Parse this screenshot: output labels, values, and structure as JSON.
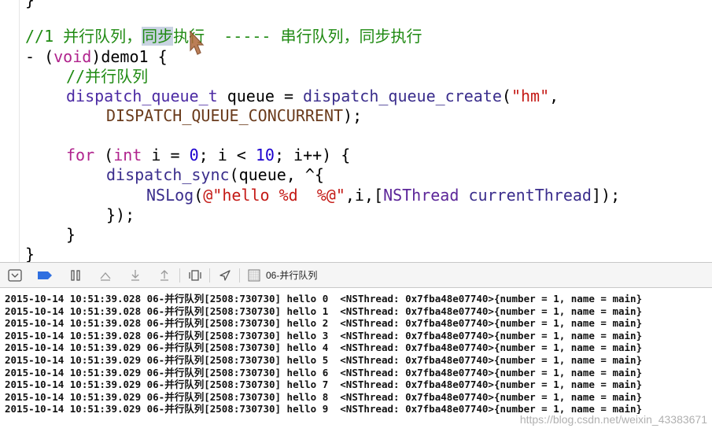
{
  "editor": {
    "prev_brace": "}",
    "comment_title": "//1 并行队列，同步执行  ----- 串行队列，同步执行",
    "comment_title_pre": "//1 并行队列，",
    "comment_title_sel": "同步",
    "comment_title_post": "执行  ----- 串行队列，同步执行",
    "method_dash": "- (",
    "method_ret": "void",
    "method_name": ")demo1 {",
    "comment_inner": "//并行队列",
    "queue_type": "dispatch_queue_t",
    "queue_var": " queue = ",
    "queue_fn": "dispatch_queue_create",
    "queue_open": "(",
    "queue_str": "\"hm\"",
    "queue_comma": ",",
    "queue_const": "DISPATCH_QUEUE_CONCURRENT",
    "queue_close": ");",
    "for_kw": "for",
    "for_open": " (",
    "for_int": "int",
    "for_a": " i = ",
    "for_zero": "0",
    "for_b": "; i < ",
    "for_ten": "10",
    "for_c": "; i++) {",
    "sync_fn": "dispatch_sync",
    "sync_rest": "(queue, ^{",
    "nslog_fn": "NSLog",
    "nslog_open": "(",
    "nslog_str": "@\"hello %d  %@\"",
    "nslog_mid": ",i,[",
    "nslog_cls": "NSThread",
    "nslog_sp": " ",
    "nslog_msg": "currentThread",
    "nslog_close": "]);",
    "block_close": "});",
    "for_close": "}",
    "method_close": "}"
  },
  "toolbar": {
    "target_label": "06-并行队列"
  },
  "console": {
    "lines": [
      "2015-10-14 10:51:39.028 06-并行队列[2508:730730] hello 0  <NSThread: 0x7fba48e07740>{number = 1, name = main}",
      "2015-10-14 10:51:39.028 06-并行队列[2508:730730] hello 1  <NSThread: 0x7fba48e07740>{number = 1, name = main}",
      "2015-10-14 10:51:39.028 06-并行队列[2508:730730] hello 2  <NSThread: 0x7fba48e07740>{number = 1, name = main}",
      "2015-10-14 10:51:39.028 06-并行队列[2508:730730] hello 3  <NSThread: 0x7fba48e07740>{number = 1, name = main}",
      "2015-10-14 10:51:39.029 06-并行队列[2508:730730] hello 4  <NSThread: 0x7fba48e07740>{number = 1, name = main}",
      "2015-10-14 10:51:39.029 06-并行队列[2508:730730] hello 5  <NSThread: 0x7fba48e07740>{number = 1, name = main}",
      "2015-10-14 10:51:39.029 06-并行队列[2508:730730] hello 6  <NSThread: 0x7fba48e07740>{number = 1, name = main}",
      "2015-10-14 10:51:39.029 06-并行队列[2508:730730] hello 7  <NSThread: 0x7fba48e07740>{number = 1, name = main}",
      "2015-10-14 10:51:39.029 06-并行队列[2508:730730] hello 8  <NSThread: 0x7fba48e07740>{number = 1, name = main}",
      "2015-10-14 10:51:39.029 06-并行队列[2508:730730] hello 9  <NSThread: 0x7fba48e07740>{number = 1, name = main}"
    ],
    "watermark": "https://blog.csdn.net/weixin_43383671"
  },
  "icons": {
    "hide_console": "console-toggle-icon",
    "breakpoints": "breakpoint-icon",
    "pause": "pause-icon",
    "step_over": "step-over-icon",
    "step_into": "step-into-icon",
    "step_out": "step-out-icon",
    "view_debugger": "view-hierarchy-icon",
    "location": "location-arrow-icon",
    "target": "target-icon",
    "colors": {
      "breakpoint": "#2f6fe0",
      "comment": "#1f8a12",
      "keyword": "#b0238d",
      "string": "#c41a16",
      "number": "#1c00cf"
    }
  }
}
